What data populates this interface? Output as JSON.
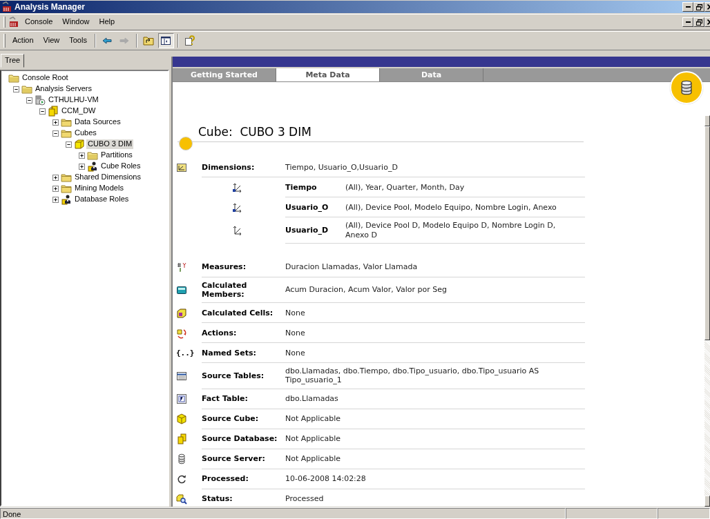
{
  "window": {
    "title": "Analysis Manager"
  },
  "menu": [
    "Console",
    "Window",
    "Help"
  ],
  "toolbar": {
    "menus": [
      "Action",
      "View",
      "Tools"
    ],
    "buttons": [
      {
        "kind": "back",
        "disabled": false,
        "pressed": false
      },
      {
        "kind": "forward",
        "disabled": true,
        "pressed": false
      },
      {
        "kind": "up",
        "pressed": false
      },
      {
        "kind": "tree-toggle",
        "pressed": true
      },
      {
        "kind": "help",
        "pressed": false
      }
    ]
  },
  "tree_tab": "Tree",
  "tree": [
    {
      "label": "Console Root",
      "kind": "special-folder",
      "selected": false,
      "children": [
        {
          "label": "Analysis Servers",
          "kind": "special-folder",
          "expanded": true,
          "selected": false,
          "children": [
            {
              "label": "CTHULHU-VM",
              "kind": "server",
              "expanded": true,
              "selected": false,
              "children": [
                {
                  "label": "CCM_DW",
                  "kind": "database",
                  "expanded": true,
                  "selected": false,
                  "children": [
                    {
                      "label": "Data Sources",
                      "kind": "folder",
                      "expanded": false,
                      "selected": false
                    },
                    {
                      "label": "Cubes",
                      "kind": "folder",
                      "expanded": true,
                      "selected": false,
                      "children": [
                        {
                          "label": "CUBO 3 DIM",
                          "kind": "cube",
                          "expanded": true,
                          "selected": true,
                          "children": [
                            {
                              "label": "Partitions",
                              "kind": "special-folder",
                              "expanded": false,
                              "selected": false
                            },
                            {
                              "label": "Cube Roles",
                              "kind": "roles",
                              "expanded": false,
                              "selected": false
                            }
                          ]
                        }
                      ]
                    },
                    {
                      "label": "Shared Dimensions",
                      "kind": "folder",
                      "expanded": false,
                      "selected": false
                    },
                    {
                      "label": "Mining Models",
                      "kind": "folder",
                      "expanded": false,
                      "selected": false
                    },
                    {
                      "label": "Database Roles",
                      "kind": "roles",
                      "expanded": false,
                      "selected": false
                    }
                  ]
                }
              ]
            }
          ]
        }
      ]
    }
  ],
  "tabs": [
    {
      "label": "Getting Started",
      "selected": false
    },
    {
      "label": "Meta Data",
      "selected": true
    },
    {
      "label": "Data",
      "selected": false
    }
  ],
  "cube_header": "Cube:  CUBO 3 DIM",
  "properties": [
    {
      "kind": "dimensions",
      "label": "Dimensions:",
      "value": "Tiempo, Usuario_O,Usuario_D",
      "children": [
        {
          "kind": "dimension",
          "name": "Tiempo",
          "levels": "(All), Year, Quarter, Month, Day"
        },
        {
          "kind": "dimension",
          "name": "Usuario_O",
          "levels": "(All), Device Pool, Modelo Equipo, Nombre Login, Anexo"
        },
        {
          "kind": "dimension-plain",
          "name": "Usuario_D",
          "levels": "(All), Device Pool D, Modelo Equipo D, Nombre Login D, Anexo D"
        }
      ]
    },
    {
      "kind": "measures",
      "label": "Measures:",
      "value": "Duracion Llamadas, Valor Llamada"
    },
    {
      "kind": "calculated-members",
      "label": "Calculated Members:",
      "value": "Acum Duracion, Acum Valor, Valor por Seg"
    },
    {
      "kind": "calculated-cells",
      "label": "Calculated Cells:",
      "value": "None"
    },
    {
      "kind": "actions",
      "label": "Actions:",
      "value": "None"
    },
    {
      "kind": "named-sets",
      "glyph": "{..}",
      "label": "Named Sets:",
      "value": "None"
    },
    {
      "kind": "source-tables",
      "label": "Source Tables:",
      "value": "dbo.Llamadas, dbo.Tiempo, dbo.Tipo_usuario, dbo.Tipo_usuario AS Tipo_usuario_1"
    },
    {
      "kind": "fact-table",
      "label": "Fact Table:",
      "value": "dbo.Llamadas"
    },
    {
      "kind": "source-cube",
      "label": "Source Cube:",
      "value": "Not Applicable"
    },
    {
      "kind": "source-database",
      "label": "Source Database:",
      "value": "Not Applicable"
    },
    {
      "kind": "source-server",
      "label": "Source Server:",
      "value": "Not Applicable"
    },
    {
      "kind": "processed",
      "label": "Processed:",
      "value": "10-06-2008 14:02:28"
    },
    {
      "kind": "status",
      "label": "Status:",
      "value": "Processed"
    }
  ],
  "status_bar": [
    "Done"
  ]
}
